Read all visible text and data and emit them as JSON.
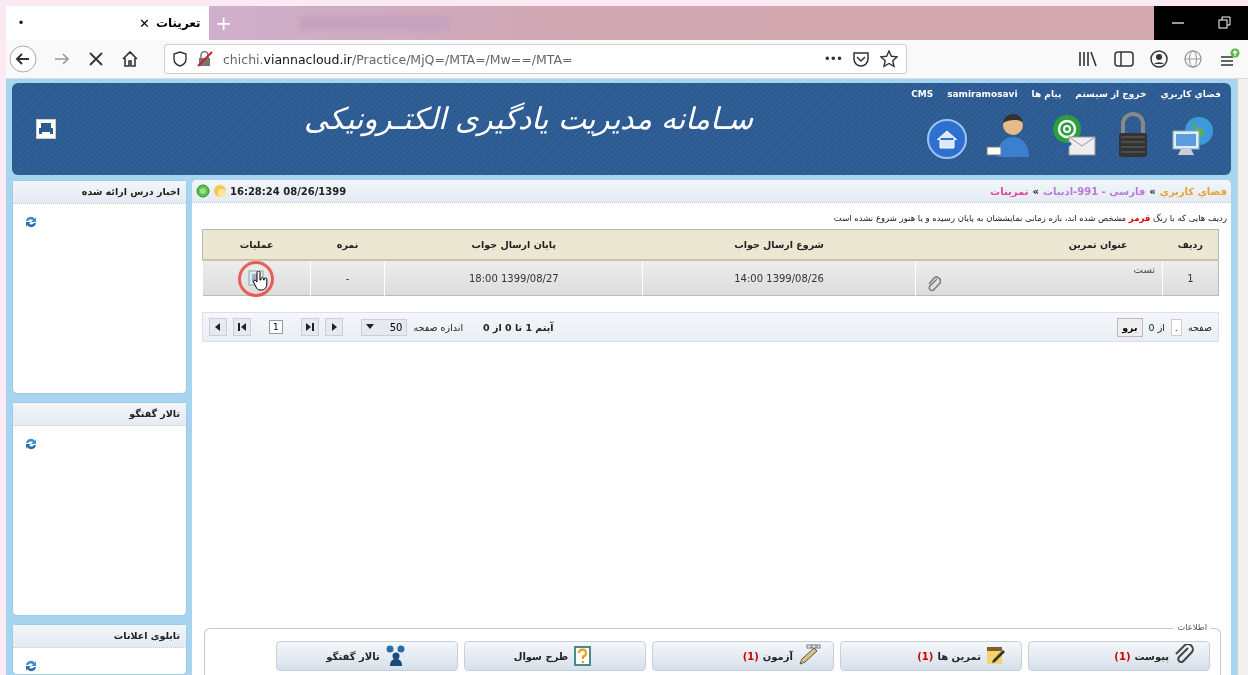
{
  "browser": {
    "dot": "•",
    "tab": {
      "close": "✕",
      "title": "تعرینات",
      "selected": true
    },
    "new_tab": "+",
    "url": "chichi.**viannacloud.ir**/Practice/MjQ=/MTA=/Mw==/MTA=",
    "page_actions": "•••"
  },
  "header": {
    "links": [
      "فضاي كاربري",
      "خروج از سيستم",
      "پيام ها",
      "samiramosavi",
      "CMS"
    ],
    "title": "سـامانه مدیریت یادگیری الکتـرونیکی"
  },
  "sidebar": {
    "panels": [
      {
        "title": "اخبار درس ارائه شده"
      },
      {
        "title": "تالار گفتگو"
      },
      {
        "title": "تابلوی اعلانات"
      }
    ]
  },
  "main": {
    "breadcrumb": [
      {
        "label": "فضاي كاربري",
        "color": "#e8a23a"
      },
      {
        "label": "فارسی - 991-ادبیات",
        "color": "#b77ad8"
      },
      {
        "label": "تمرینات",
        "color": "#e0489a"
      }
    ],
    "separator": "»",
    "datetime": "16:28:24 08/26/1399",
    "note": "ردیف هایی که با رنگ **قرمز** مشخص شده اند، بازه زمانی نمایششان به پایان رسیده و یا هنوز شروع نشده است",
    "table": {
      "columns": [
        "ردیف",
        "عنوان تمرین",
        "شروع ارسال جواب",
        "پایان ارسال جواب",
        "نمره",
        "عملیات"
      ],
      "rows": [
        {
          "index": "1",
          "title": "تست",
          "start": "1399/08/26 14:00",
          "end": "1399/08/27 18:00",
          "grade": "-",
          "highlighted": true
        }
      ]
    },
    "pager": {
      "page_label": "صفحه",
      "page_value": ".",
      "of": "از 0",
      "go": "برو",
      "items": "آیتم 1 تا 0 از 0",
      "size_label": "اندازه صفحه",
      "size": "50",
      "page_box": "1"
    },
    "info": {
      "legend": "اطلاعات",
      "buttons": [
        {
          "kind": "attachment",
          "label": "پیوست",
          "count": "(1)"
        },
        {
          "kind": "exercise",
          "label": "تمرین ها",
          "count": "(1)"
        },
        {
          "kind": "exam",
          "label": "آزمون",
          "count": "(1)"
        },
        {
          "kind": "question",
          "label": "طرح سوال"
        },
        {
          "kind": "forum",
          "label": "تالار گفتگو"
        }
      ]
    }
  }
}
